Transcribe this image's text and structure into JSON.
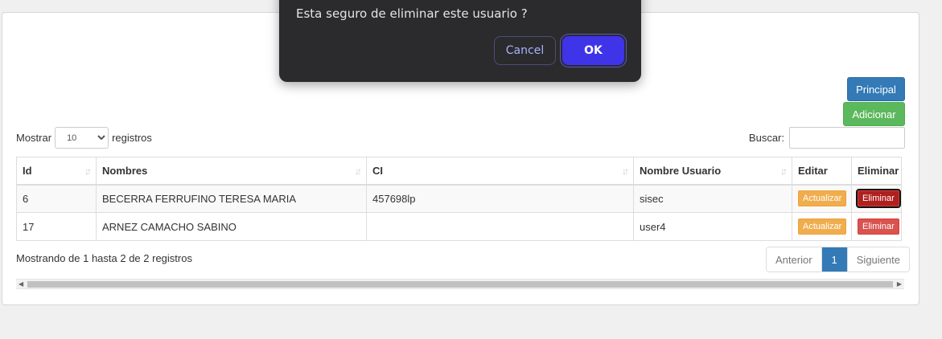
{
  "toolbar": {
    "principal_label": "Principal",
    "adicionar_label": "Adicionar"
  },
  "length": {
    "prefix": "Mostrar",
    "selected": "10",
    "suffix": "registros"
  },
  "search": {
    "label": "Buscar:",
    "value": ""
  },
  "table": {
    "headers": [
      "Id",
      "Nombres",
      "CI",
      "Nombre Usuario",
      "Editar",
      "Eliminar"
    ],
    "rows": [
      {
        "id": "6",
        "nombres": "BECERRA FERRUFINO TERESA MARIA",
        "ci": "457698lp",
        "usuario": "sisec",
        "edit": "Actualizar",
        "delete": "Eliminar"
      },
      {
        "id": "17",
        "nombres": "ARNEZ CAMACHO SABINO",
        "ci": "",
        "usuario": "user4",
        "edit": "Actualizar",
        "delete": "Eliminar"
      }
    ]
  },
  "info": "Mostrando de 1 hasta 2 de 2 registros",
  "pager": {
    "prev": "Anterior",
    "current": "1",
    "next": "Siguiente"
  },
  "dialog": {
    "message": "Esta seguro de eliminar este usuario ?",
    "cancel_label": "Cancel",
    "ok_label": "OK"
  },
  "colors": {
    "primary": "#337ab7",
    "success": "#5cb85c",
    "warning": "#f0ad4e",
    "danger": "#d9534f",
    "dialog_bg": "#2b2b2d",
    "dialog_ok": "#3f34e8"
  }
}
